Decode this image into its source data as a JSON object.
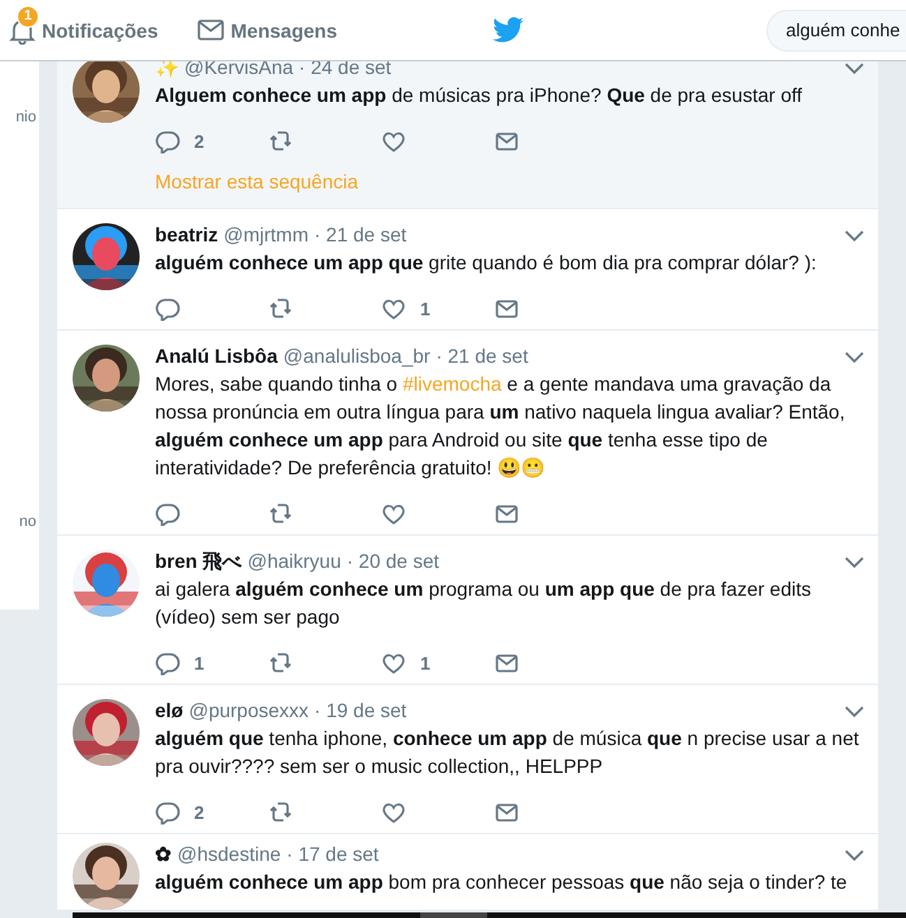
{
  "nav": {
    "notifications": {
      "label": "Notificações",
      "badge": "1"
    },
    "messages": {
      "label": "Mensagens"
    },
    "search": {
      "value": "alguém conhe"
    }
  },
  "sidebar": {
    "texts": [
      "nio",
      "no"
    ]
  },
  "tweets": [
    {
      "name": "✨",
      "handle": "@KervisAna",
      "date": "· 24 de set",
      "text": "**Alguem conhece um app** de músicas pra iPhone? **Que** de pra esustar off",
      "replies": "2",
      "thread_link": "Mostrar esta sequência",
      "highlighted": true
    },
    {
      "name": "beatriz",
      "handle": "@mjrtmm",
      "date": "· 21 de set",
      "text": "**alguém conhece um app que** grite quando é bom dia pra comprar dólar? ):",
      "likes": "1",
      "highlighted": false
    },
    {
      "name": "Analú Lisbôa",
      "handle": "@analulisboa_br",
      "date": "· 21 de set",
      "text": "Mores, sabe quando tinha o ",
      "hashtag": "#livemocha",
      "text_after": " e a gente mandava uma gravação da nossa pronúncia em outra língua para **um** nativo naquela lingua avaliar? Então, **alguém conhece um app** para Android ou site **que** tenha esse tipo de interatividade? De preferência gratuito! 😃😬",
      "highlighted": false
    },
    {
      "name": "bren 飛べ",
      "handle": "@haikryuu",
      "date": "· 20 de set",
      "text": "ai galera **alguém conhece um** programa ou **um app que** de pra fazer edits (vídeo) sem ser pago",
      "replies": "1",
      "likes": "1",
      "highlighted": false
    },
    {
      "name": "elø",
      "handle": "@purposexxx",
      "date": "· 19 de set",
      "text": "**alguém que** tenha iphone, **conhece um app** de música **que** n precise usar a net pra ouvir???? sem ser o music collection,, HELPPP",
      "replies": "2",
      "highlighted": false
    },
    {
      "name": "✿",
      "handle": "@hsdestine",
      "date": "· 17 de set",
      "text": "**alguém conhece um app** bom pra conhecer pessoas **que** não seja o tinder? te",
      "highlighted": false,
      "actions_visible": false
    }
  ]
}
